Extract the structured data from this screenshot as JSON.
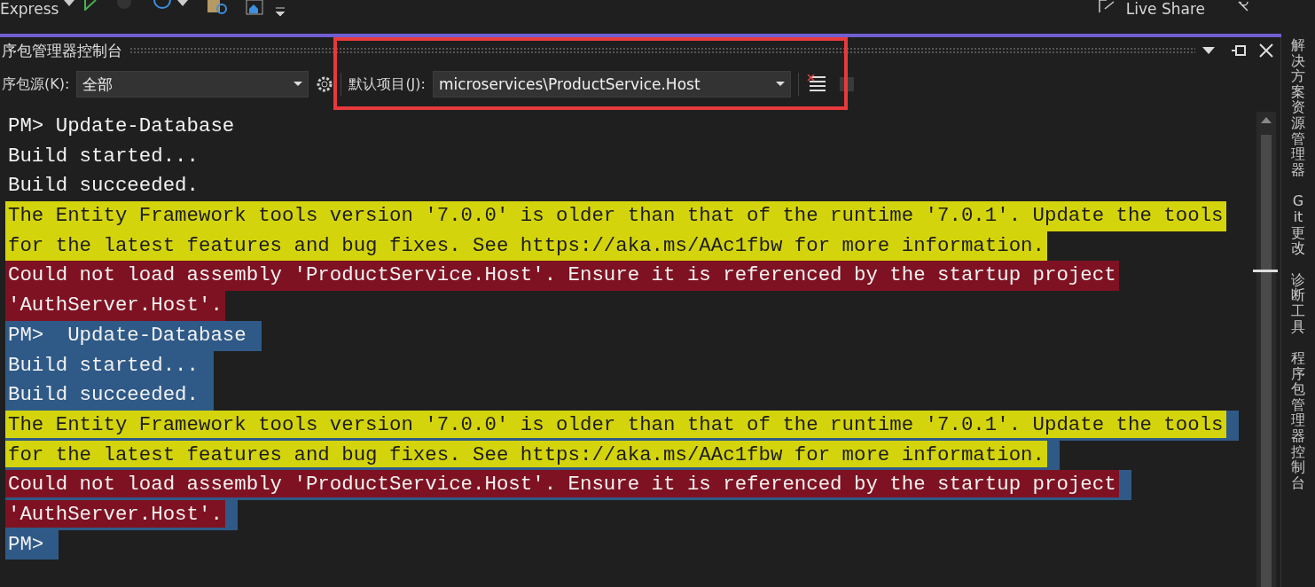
{
  "toolbar": {
    "config": "Express",
    "live_share": "Live Share"
  },
  "panel": {
    "title": "序包管理器控制台",
    "source_label": "序包源(K):",
    "source_value": "全部",
    "project_label": "默认项目(J):",
    "project_value": "microservices\\ProductService.Host",
    "highlighted": true
  },
  "console_lines": [
    {
      "text": "PM> Update-Database",
      "kind": "normal",
      "selected": false
    },
    {
      "text": "Build started...",
      "kind": "normal",
      "selected": false
    },
    {
      "text": "Build succeeded.",
      "kind": "normal",
      "selected": false
    },
    {
      "text": "The Entity Framework tools version '7.0.0' is older than that of the runtime '7.0.1'. Update the tools",
      "kind": "warning",
      "selected": false
    },
    {
      "text": "for the latest features and bug fixes. See https://aka.ms/AAc1fbw for more information.",
      "kind": "warning",
      "selected": false
    },
    {
      "text": "Could not load assembly 'ProductService.Host'. Ensure it is referenced by the startup project",
      "kind": "error",
      "selected": false
    },
    {
      "text": "'AuthServer.Host'.",
      "kind": "error",
      "selected": false
    },
    {
      "text": "PM>  Update-Database",
      "kind": "normal",
      "selected": true
    },
    {
      "text": "Build started...",
      "kind": "normal",
      "selected": true
    },
    {
      "text": "Build succeeded.",
      "kind": "normal",
      "selected": true
    },
    {
      "text": "The Entity Framework tools version '7.0.0' is older than that of the runtime '7.0.1'. Update the tools",
      "kind": "warning",
      "selected": true
    },
    {
      "text": "for the latest features and bug fixes. See https://aka.ms/AAc1fbw for more information.",
      "kind": "warning",
      "selected": true
    },
    {
      "text": "Could not load assembly 'ProductService.Host'. Ensure it is referenced by the startup project",
      "kind": "error",
      "selected": true
    },
    {
      "text": "'AuthServer.Host'.",
      "kind": "error",
      "selected": true
    },
    {
      "text": "PM>",
      "kind": "normal",
      "selected": true
    }
  ],
  "side_tabs": [
    {
      "label": "解决方案资源管理器"
    },
    {
      "label": "Git 更改"
    },
    {
      "label": "诊断工具"
    },
    {
      "label": "程序包管理器控制台"
    }
  ]
}
